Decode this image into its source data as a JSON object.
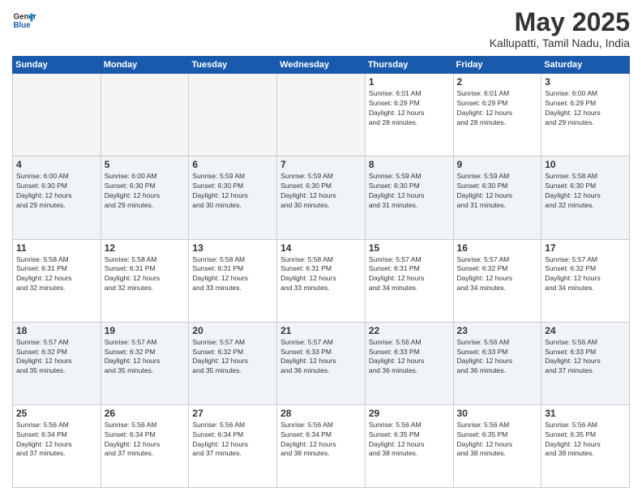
{
  "header": {
    "logo_line1": "General",
    "logo_line2": "Blue",
    "month": "May 2025",
    "location": "Kallupatti, Tamil Nadu, India"
  },
  "weekdays": [
    "Sunday",
    "Monday",
    "Tuesday",
    "Wednesday",
    "Thursday",
    "Friday",
    "Saturday"
  ],
  "weeks": [
    [
      {
        "day": "",
        "info": ""
      },
      {
        "day": "",
        "info": ""
      },
      {
        "day": "",
        "info": ""
      },
      {
        "day": "",
        "info": ""
      },
      {
        "day": "1",
        "info": "Sunrise: 6:01 AM\nSunset: 6:29 PM\nDaylight: 12 hours\nand 28 minutes."
      },
      {
        "day": "2",
        "info": "Sunrise: 6:01 AM\nSunset: 6:29 PM\nDaylight: 12 hours\nand 28 minutes."
      },
      {
        "day": "3",
        "info": "Sunrise: 6:00 AM\nSunset: 6:29 PM\nDaylight: 12 hours\nand 29 minutes."
      }
    ],
    [
      {
        "day": "4",
        "info": "Sunrise: 6:00 AM\nSunset: 6:30 PM\nDaylight: 12 hours\nand 29 minutes."
      },
      {
        "day": "5",
        "info": "Sunrise: 6:00 AM\nSunset: 6:30 PM\nDaylight: 12 hours\nand 29 minutes."
      },
      {
        "day": "6",
        "info": "Sunrise: 5:59 AM\nSunset: 6:30 PM\nDaylight: 12 hours\nand 30 minutes."
      },
      {
        "day": "7",
        "info": "Sunrise: 5:59 AM\nSunset: 6:30 PM\nDaylight: 12 hours\nand 30 minutes."
      },
      {
        "day": "8",
        "info": "Sunrise: 5:59 AM\nSunset: 6:30 PM\nDaylight: 12 hours\nand 31 minutes."
      },
      {
        "day": "9",
        "info": "Sunrise: 5:59 AM\nSunset: 6:30 PM\nDaylight: 12 hours\nand 31 minutes."
      },
      {
        "day": "10",
        "info": "Sunrise: 5:58 AM\nSunset: 6:30 PM\nDaylight: 12 hours\nand 32 minutes."
      }
    ],
    [
      {
        "day": "11",
        "info": "Sunrise: 5:58 AM\nSunset: 6:31 PM\nDaylight: 12 hours\nand 32 minutes."
      },
      {
        "day": "12",
        "info": "Sunrise: 5:58 AM\nSunset: 6:31 PM\nDaylight: 12 hours\nand 32 minutes."
      },
      {
        "day": "13",
        "info": "Sunrise: 5:58 AM\nSunset: 6:31 PM\nDaylight: 12 hours\nand 33 minutes."
      },
      {
        "day": "14",
        "info": "Sunrise: 5:58 AM\nSunset: 6:31 PM\nDaylight: 12 hours\nand 33 minutes."
      },
      {
        "day": "15",
        "info": "Sunrise: 5:57 AM\nSunset: 6:31 PM\nDaylight: 12 hours\nand 34 minutes."
      },
      {
        "day": "16",
        "info": "Sunrise: 5:57 AM\nSunset: 6:32 PM\nDaylight: 12 hours\nand 34 minutes."
      },
      {
        "day": "17",
        "info": "Sunrise: 5:57 AM\nSunset: 6:32 PM\nDaylight: 12 hours\nand 34 minutes."
      }
    ],
    [
      {
        "day": "18",
        "info": "Sunrise: 5:57 AM\nSunset: 6:32 PM\nDaylight: 12 hours\nand 35 minutes."
      },
      {
        "day": "19",
        "info": "Sunrise: 5:57 AM\nSunset: 6:32 PM\nDaylight: 12 hours\nand 35 minutes."
      },
      {
        "day": "20",
        "info": "Sunrise: 5:57 AM\nSunset: 6:32 PM\nDaylight: 12 hours\nand 35 minutes."
      },
      {
        "day": "21",
        "info": "Sunrise: 5:57 AM\nSunset: 6:33 PM\nDaylight: 12 hours\nand 36 minutes."
      },
      {
        "day": "22",
        "info": "Sunrise: 5:56 AM\nSunset: 6:33 PM\nDaylight: 12 hours\nand 36 minutes."
      },
      {
        "day": "23",
        "info": "Sunrise: 5:56 AM\nSunset: 6:33 PM\nDaylight: 12 hours\nand 36 minutes."
      },
      {
        "day": "24",
        "info": "Sunrise: 5:56 AM\nSunset: 6:33 PM\nDaylight: 12 hours\nand 37 minutes."
      }
    ],
    [
      {
        "day": "25",
        "info": "Sunrise: 5:56 AM\nSunset: 6:34 PM\nDaylight: 12 hours\nand 37 minutes."
      },
      {
        "day": "26",
        "info": "Sunrise: 5:56 AM\nSunset: 6:34 PM\nDaylight: 12 hours\nand 37 minutes."
      },
      {
        "day": "27",
        "info": "Sunrise: 5:56 AM\nSunset: 6:34 PM\nDaylight: 12 hours\nand 37 minutes."
      },
      {
        "day": "28",
        "info": "Sunrise: 5:56 AM\nSunset: 6:34 PM\nDaylight: 12 hours\nand 38 minutes."
      },
      {
        "day": "29",
        "info": "Sunrise: 5:56 AM\nSunset: 6:35 PM\nDaylight: 12 hours\nand 38 minutes."
      },
      {
        "day": "30",
        "info": "Sunrise: 5:56 AM\nSunset: 6:35 PM\nDaylight: 12 hours\nand 38 minutes."
      },
      {
        "day": "31",
        "info": "Sunrise: 5:56 AM\nSunset: 6:35 PM\nDaylight: 12 hours\nand 38 minutes."
      }
    ]
  ]
}
